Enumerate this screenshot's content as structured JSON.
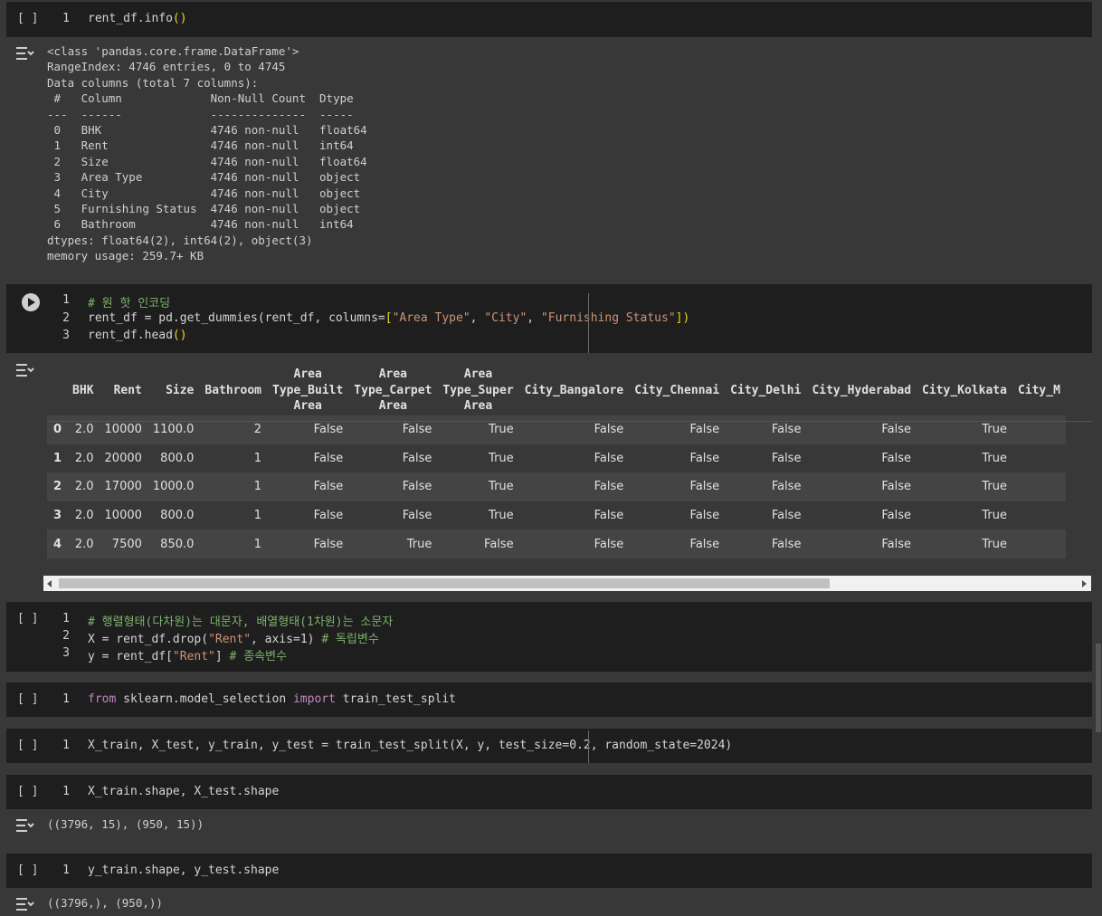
{
  "cells": {
    "c1": {
      "gutter": "[ ]",
      "line1": "1",
      "code1": "rent_df.info",
      "paren": "()"
    },
    "c2": {
      "ln1": "1",
      "ln2": "2",
      "ln3": "3",
      "comment": "# 원 핫 인코딩",
      "code2a": "rent_df = pd.get_dummies(rent_df, columns=",
      "bracket_open": "[",
      "s1": "\"Area Type\"",
      "comma": ", ",
      "s2": "\"City\"",
      "s3": "\"Furnishing Status\"",
      "bracket_close": "])",
      "code3": "rent_df.head",
      "code3p": "()"
    },
    "c3": {
      "gutter": "[ ]",
      "ln1": "1",
      "ln2": "2",
      "ln3": "3",
      "comment1": "# 행렬형태(다차원)는 대문자, 배열형태(1차원)는 소문자",
      "code2a": "X = rent_df.drop(",
      "s_rent": "\"Rent\"",
      "code2b": ", axis=1) ",
      "comment2": "# 독립변수",
      "code3a": "y = rent_df[",
      "s_rent2": "\"Rent\"",
      "code3b": "] ",
      "comment3": "# 종속변수"
    },
    "c4": {
      "gutter": "[ ]",
      "ln": "1",
      "kw_from": "from",
      "mod": " sklearn.model_selection ",
      "kw_import": "import",
      "fn": " train_test_split"
    },
    "c5": {
      "gutter": "[ ]",
      "ln": "1",
      "code": "X_train, X_test, y_train, y_test = train_test_split(X, y, test_size=0.2, random_state=2024)"
    },
    "c6": {
      "gutter": "[ ]",
      "ln": "1",
      "code": "X_train.shape, X_test.shape",
      "output": "((3796, 15), (950, 15))"
    },
    "c7": {
      "gutter": "[ ]",
      "ln": "1",
      "code": "y_train.shape, y_test.shape",
      "output": "((3796,), (950,))"
    }
  },
  "info_output": [
    "<class 'pandas.core.frame.DataFrame'>",
    "RangeIndex: 4746 entries, 0 to 4745",
    "Data columns (total 7 columns):",
    " #   Column             Non-Null Count  Dtype  ",
    "---  ------             --------------  -----  ",
    " 0   BHK                4746 non-null   float64",
    " 1   Rent               4746 non-null   int64  ",
    " 2   Size               4746 non-null   float64",
    " 3   Area Type          4746 non-null   object ",
    " 4   City               4746 non-null   object ",
    " 5   Furnishing Status  4746 non-null   object ",
    " 6   Bathroom           4746 non-null   int64  ",
    "dtypes: float64(2), int64(2), object(3)",
    "memory usage: 259.7+ KB"
  ],
  "df_table": {
    "headers": [
      "",
      "BHK",
      "Rent",
      "Size",
      "Bathroom",
      "Area Type_Built Area",
      "Area Type_Carpet Area",
      "Area Type_Super Area",
      "City_Bangalore",
      "City_Chennai",
      "City_Delhi",
      "City_Hyderabad",
      "City_Kolkata",
      "City_M"
    ],
    "header_lines": {
      "h5": [
        "Area",
        "Type_Built",
        "Area"
      ],
      "h6": [
        "Area",
        "Type_Carpet",
        "Area"
      ],
      "h7": [
        "Area",
        "Type_Super",
        "Area"
      ]
    },
    "rows": [
      [
        "0",
        "2.0",
        "10000",
        "1100.0",
        "2",
        "False",
        "False",
        "True",
        "False",
        "False",
        "False",
        "False",
        "True"
      ],
      [
        "1",
        "2.0",
        "20000",
        "800.0",
        "1",
        "False",
        "False",
        "True",
        "False",
        "False",
        "False",
        "False",
        "True"
      ],
      [
        "2",
        "2.0",
        "17000",
        "1000.0",
        "1",
        "False",
        "False",
        "True",
        "False",
        "False",
        "False",
        "False",
        "True"
      ],
      [
        "3",
        "2.0",
        "10000",
        "800.0",
        "1",
        "False",
        "False",
        "True",
        "False",
        "False",
        "False",
        "False",
        "True"
      ],
      [
        "4",
        "2.0",
        "7500",
        "850.0",
        "1",
        "False",
        "True",
        "False",
        "False",
        "False",
        "False",
        "False",
        "True"
      ]
    ]
  },
  "icons": {
    "output_toggle": "output-toggle-icon",
    "run": "play-icon"
  },
  "colors": {
    "cell_bg": "#1e1e1e",
    "page_bg": "#383838",
    "comment": "#7bb36b",
    "string": "#ce9178",
    "bracket": "#f1d71c",
    "keyword": "#c586c0"
  }
}
